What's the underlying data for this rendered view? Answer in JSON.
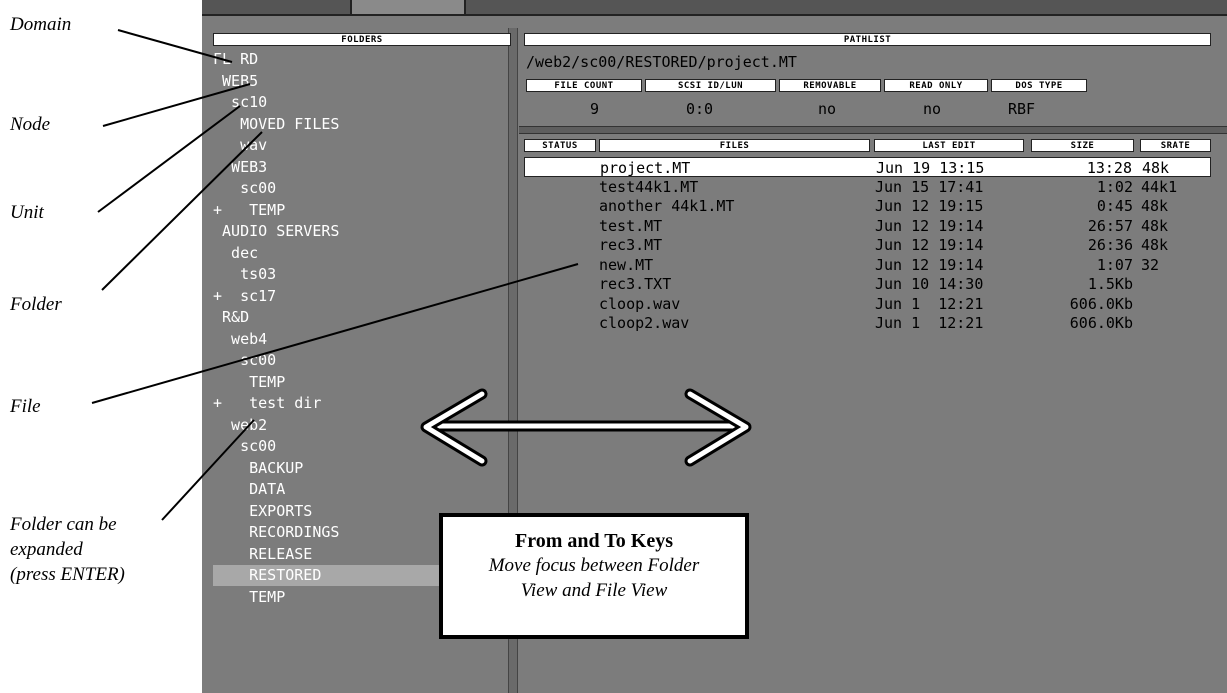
{
  "callouts": {
    "domain": "Domain",
    "node": "Node",
    "unit": "Unit",
    "folder": "Folder",
    "file": "File",
    "expand_line1": "Folder can be",
    "expand_line2": "expanded",
    "expand_line3": "(press ENTER)"
  },
  "folders_panel": {
    "header": "FOLDERS",
    "items": [
      {
        "text": "FL RD"
      },
      {
        "text": " WEB5"
      },
      {
        "text": "  sc10"
      },
      {
        "text": "   MOVED FILES"
      },
      {
        "text": "   wav"
      },
      {
        "text": "  WEB3"
      },
      {
        "text": "   sc00"
      },
      {
        "text": "+   TEMP"
      },
      {
        "text": " AUDIO SERVERS"
      },
      {
        "text": "  dec"
      },
      {
        "text": "   ts03"
      },
      {
        "text": "+  sc17"
      },
      {
        "text": " R&D"
      },
      {
        "text": "  web4"
      },
      {
        "text": "   sc00"
      },
      {
        "text": "    TEMP"
      },
      {
        "text": "+   test dir"
      },
      {
        "text": "  web2"
      },
      {
        "text": "   sc00"
      },
      {
        "text": "    BACKUP"
      },
      {
        "text": "    DATA"
      },
      {
        "text": "    EXPORTS"
      },
      {
        "text": "    RECORDINGS"
      },
      {
        "text": "    RELEASE"
      },
      {
        "text": "    RESTORED",
        "selected": true
      },
      {
        "text": "    TEMP"
      }
    ]
  },
  "pathlist": {
    "header": "PATHLIST",
    "value": "/web2/sc00/RESTORED/project.MT",
    "attributes": [
      {
        "label": "FILE COUNT",
        "value": "9"
      },
      {
        "label": "SCSI ID/LUN",
        "value": "0:0"
      },
      {
        "label": "REMOVABLE",
        "value": "no"
      },
      {
        "label": "READ ONLY",
        "value": "no"
      },
      {
        "label": "DOS TYPE",
        "value": "RBF"
      }
    ]
  },
  "files_panel": {
    "headers": {
      "status": "STATUS",
      "files": "FILES",
      "last_edit": "LAST EDIT",
      "size": "SIZE",
      "srate": "SRATE"
    },
    "rows": [
      {
        "name": "project.MT",
        "date": "Jun 19 13:15",
        "size": "13:28",
        "srate": "48k",
        "selected": true
      },
      {
        "name": "test44k1.MT",
        "date": "Jun 15 17:41",
        "size": "1:02",
        "srate": "44k1"
      },
      {
        "name": "another 44k1.MT",
        "date": "Jun 12 19:15",
        "size": "0:45",
        "srate": "48k"
      },
      {
        "name": "test.MT",
        "date": "Jun 12 19:14",
        "size": "26:57",
        "srate": "48k"
      },
      {
        "name": "rec3.MT",
        "date": "Jun 12 19:14",
        "size": "26:36",
        "srate": "48k"
      },
      {
        "name": "new.MT",
        "date": "Jun 12 19:14",
        "size": "1:07",
        "srate": "32"
      },
      {
        "name": "rec3.TXT",
        "date": "Jun 10 14:30",
        "size": "1.5Kb",
        "srate": ""
      },
      {
        "name": "cloop.wav",
        "date": "Jun 1  12:21",
        "size": "606.0Kb",
        "srate": ""
      },
      {
        "name": "cloop2.wav",
        "date": "Jun 1  12:21",
        "size": "606.0Kb",
        "srate": ""
      }
    ]
  },
  "keys_box": {
    "title": "From and To Keys",
    "line1": "Move focus between Folder",
    "line2": "View and File View"
  }
}
